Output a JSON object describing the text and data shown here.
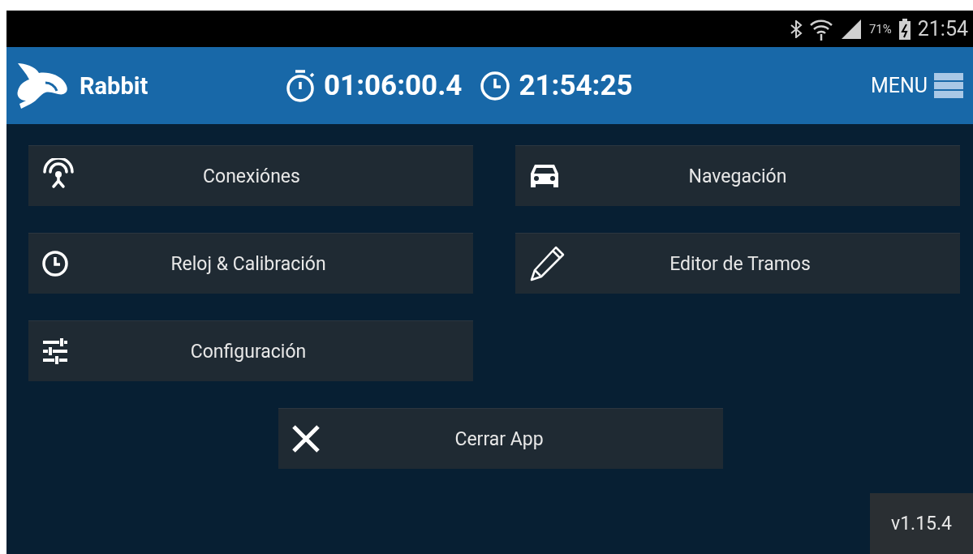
{
  "status_bar": {
    "battery": "71%",
    "time": "21:54"
  },
  "app_bar": {
    "title": "Rabbit",
    "stopwatch": "01:06:00.4",
    "clock": "21:54:25",
    "menu": "MENU"
  },
  "buttons": [
    {
      "label": "Conexiónes"
    },
    {
      "label": "Navegación"
    },
    {
      "label": "Reloj & Calibración"
    },
    {
      "label": "Editor de Tramos"
    },
    {
      "label": "Configuración"
    }
  ],
  "close_button": {
    "label": "Cerrar App"
  },
  "version": "v1.15.4"
}
